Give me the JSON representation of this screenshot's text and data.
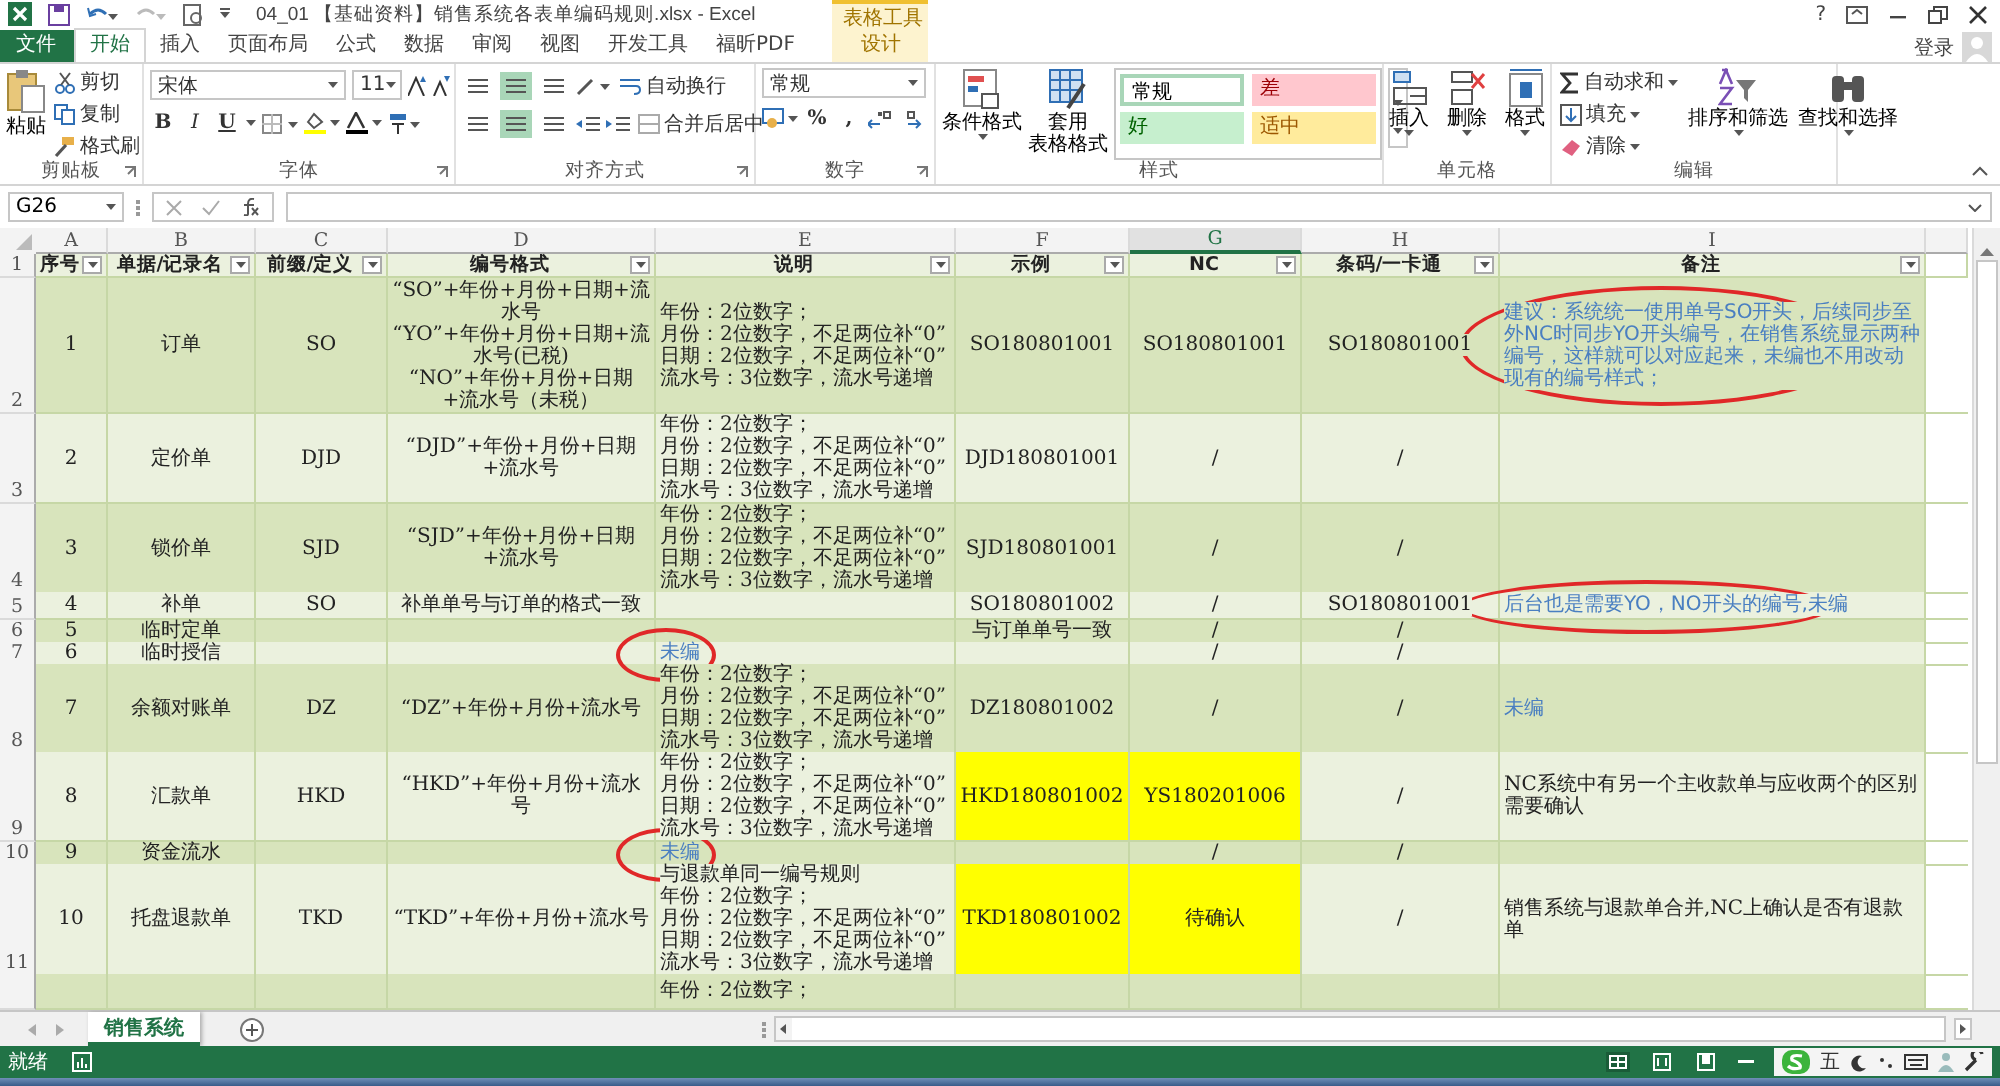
{
  "title_bar": {
    "title": "04_01  【基础资料】销售系统各表单编码规则.xlsx - Excel",
    "context_label": "表格工具",
    "help": "?",
    "login": "登录"
  },
  "ribbon_tabs": [
    {
      "label": "文件",
      "kind": "file",
      "selected": false
    },
    {
      "label": "开始",
      "kind": "normal",
      "selected": true
    },
    {
      "label": "插入",
      "kind": "normal",
      "selected": false
    },
    {
      "label": "页面布局",
      "kind": "normal",
      "selected": false
    },
    {
      "label": "公式",
      "kind": "normal",
      "selected": false
    },
    {
      "label": "数据",
      "kind": "normal",
      "selected": false
    },
    {
      "label": "审阅",
      "kind": "normal",
      "selected": false
    },
    {
      "label": "视图",
      "kind": "normal",
      "selected": false
    },
    {
      "label": "开发工具",
      "kind": "normal",
      "selected": false
    },
    {
      "label": "福昕PDF",
      "kind": "normal",
      "selected": false
    },
    {
      "label": "设计",
      "kind": "context",
      "selected": false
    }
  ],
  "ribbon": {
    "clipboard": {
      "paste": "粘贴",
      "cut": "剪切",
      "copy": "复制",
      "format_painter": "格式刷",
      "label": "剪贴板"
    },
    "font": {
      "name": "宋体",
      "size": "11",
      "styles": [
        "B",
        "I",
        "U"
      ],
      "label": "字体"
    },
    "alignment": {
      "wrap_text": "自动换行",
      "merge_center": "合并后居中",
      "label": "对齐方式"
    },
    "number": {
      "format": "常规",
      "symbols": [
        "%",
        ","
      ],
      "label": "数字"
    },
    "styles": {
      "conditional": "条件格式",
      "table_format": [
        "套用",
        "表格格式"
      ],
      "cell_styles": [
        {
          "label": "常规",
          "kind": "normal",
          "color": "#ffffff"
        },
        {
          "label": "差",
          "kind": "bad",
          "color": "#ffc7ce"
        },
        {
          "label": "好",
          "kind": "good",
          "color": "#c6efce"
        },
        {
          "label": "适中",
          "kind": "neutral",
          "color": "#ffeb9c"
        }
      ],
      "label": "样式"
    },
    "cells": {
      "insert": "插入",
      "delete": "删除",
      "format": "格式",
      "label": "单元格"
    },
    "editing": {
      "autosum": "自动求和",
      "fill": "填充",
      "clear": "清除",
      "sort_filter": "排序和筛选",
      "find_select": "查找和选择",
      "label": "编辑"
    }
  },
  "formula_bar": {
    "name_box": "G26"
  },
  "sheet": {
    "columns": [
      {
        "letter": "A",
        "selected": false
      },
      {
        "letter": "B",
        "selected": false
      },
      {
        "letter": "C",
        "selected": false
      },
      {
        "letter": "D",
        "selected": false
      },
      {
        "letter": "E",
        "selected": false
      },
      {
        "letter": "F",
        "selected": false
      },
      {
        "letter": "G",
        "selected": true
      },
      {
        "letter": "H",
        "selected": false
      },
      {
        "letter": "I",
        "selected": false
      }
    ],
    "header_row": "1",
    "headers": [
      "序号",
      "单据/记录名",
      "前缀/定义",
      "编号格式",
      "说明",
      "示例",
      "NC",
      "条码/一卡通",
      "备注"
    ],
    "rows": [
      {
        "number": "2",
        "cells": [
          {
            "text": "1",
            "kind": "plain",
            "circled": false
          },
          {
            "text": "订单",
            "kind": "plain",
            "circled": false
          },
          {
            "text": "SO",
            "kind": "plain",
            "circled": false
          },
          {
            "lines": [
              "“SO”+年份+月份+日期+流水号",
              "“YO”+年份+月份+日期+流水号(已税)",
              "“NO”+年份+月份+日期+流水号（未税）"
            ],
            "kind": "plain",
            "circled": false
          },
          {
            "lines": [
              "年份：2位数字；",
              "月份：2位数字，不足两位补“0”",
              "日期：2位数字，不足两位补“0”",
              "流水号：3位数字，流水号递增"
            ],
            "kind": "plain",
            "circled": false
          },
          {
            "text": "SO180801001",
            "kind": "plain",
            "circled": false
          },
          {
            "text": "SO180801001",
            "kind": "plain",
            "circled": false
          },
          {
            "text": "SO180801001",
            "kind": "plain",
            "circled": false
          },
          {
            "text": "建议：系统统一使用单号SO开头，后续同步至外NC时同步YO开头编号，在销售系统显示两种编号，这样就可以对应起来，未编也不用改动现有的编号样式；",
            "kind": "note",
            "circled": true
          }
        ]
      },
      {
        "number": "3",
        "cells": [
          {
            "text": "2",
            "kind": "plain",
            "circled": false
          },
          {
            "text": "定价单",
            "kind": "plain",
            "circled": false
          },
          {
            "text": "DJD",
            "kind": "plain",
            "circled": false
          },
          {
            "text": "“DJD”+年份+月份+日期+流水号",
            "kind": "plain",
            "circled": false
          },
          {
            "lines": [
              "年份：2位数字；",
              "月份：2位数字，不足两位补“0”",
              "日期：2位数字，不足两位补“0”",
              "流水号：3位数字，流水号递增"
            ],
            "kind": "plain",
            "circled": false
          },
          {
            "text": "DJD180801001",
            "kind": "plain",
            "circled": false
          },
          {
            "text": "/",
            "kind": "plain",
            "circled": false
          },
          {
            "text": "/",
            "kind": "plain",
            "circled": false
          },
          {
            "kind": "plain",
            "circled": false
          }
        ]
      },
      {
        "number": "4",
        "cells": [
          {
            "text": "3",
            "kind": "plain",
            "circled": false
          },
          {
            "text": "锁价单",
            "kind": "plain",
            "circled": false
          },
          {
            "text": "SJD",
            "kind": "plain",
            "circled": false
          },
          {
            "text": "“SJD”+年份+月份+日期+流水号",
            "kind": "plain",
            "circled": false
          },
          {
            "lines": [
              "年份：2位数字；",
              "月份：2位数字，不足两位补“0”",
              "日期：2位数字，不足两位补“0”",
              "流水号：3位数字，流水号递增"
            ],
            "kind": "plain",
            "circled": false
          },
          {
            "text": "SJD180801001",
            "kind": "plain",
            "circled": false
          },
          {
            "text": "/",
            "kind": "plain",
            "circled": false
          },
          {
            "text": "/",
            "kind": "plain",
            "circled": false
          },
          {
            "kind": "plain",
            "circled": false
          }
        ]
      },
      {
        "number": "5",
        "cells": [
          {
            "text": "4",
            "kind": "plain",
            "circled": false
          },
          {
            "text": "补单",
            "kind": "plain",
            "circled": false
          },
          {
            "text": "SO",
            "kind": "plain",
            "circled": false
          },
          {
            "text": "补单单号与订单的格式一致",
            "kind": "plain",
            "circled": false
          },
          {
            "kind": "plain",
            "circled": false
          },
          {
            "text": "SO180801002",
            "kind": "plain",
            "circled": false
          },
          {
            "text": "/",
            "kind": "plain",
            "circled": false
          },
          {
            "text": "SO180801001",
            "kind": "plain",
            "circled": false
          },
          {
            "text": "后台也是需要YO，NO开头的编号,未编",
            "kind": "note",
            "circled": true
          }
        ]
      },
      {
        "number": "6",
        "cells": [
          {
            "text": "5",
            "kind": "plain",
            "circled": false
          },
          {
            "text": "临时定单",
            "kind": "plain",
            "circled": false
          },
          {
            "kind": "plain",
            "circled": false
          },
          {
            "kind": "plain",
            "circled": false
          },
          {
            "kind": "plain",
            "circled": false
          },
          {
            "text": "与订单单号一致",
            "kind": "plain",
            "circled": false
          },
          {
            "text": "/",
            "kind": "plain",
            "circled": false
          },
          {
            "text": "/",
            "kind": "plain",
            "circled": false
          },
          {
            "kind": "plain",
            "circled": false
          }
        ]
      },
      {
        "number": "7",
        "cells": [
          {
            "text": "6",
            "kind": "plain",
            "circled": false
          },
          {
            "text": "临时授信",
            "kind": "plain",
            "circled": false
          },
          {
            "kind": "plain",
            "circled": false
          },
          {
            "kind": "plain",
            "circled": false
          },
          {
            "text": "未编",
            "kind": "note",
            "circled": true
          },
          {
            "kind": "plain",
            "circled": false
          },
          {
            "text": "/",
            "kind": "plain",
            "circled": false
          },
          {
            "text": "/",
            "kind": "plain",
            "circled": false
          },
          {
            "kind": "plain",
            "circled": false
          }
        ]
      },
      {
        "number": "8",
        "cells": [
          {
            "text": "7",
            "kind": "plain",
            "circled": false
          },
          {
            "text": "余额对账单",
            "kind": "plain",
            "circled": false
          },
          {
            "text": "DZ",
            "kind": "plain",
            "circled": false
          },
          {
            "text": "“DZ”+年份+月份+流水号",
            "kind": "plain",
            "circled": false
          },
          {
            "lines": [
              "年份：2位数字；",
              "月份：2位数字，不足两位补“0”",
              "日期：2位数字，不足两位补“0”",
              "流水号：3位数字，流水号递增"
            ],
            "kind": "plain",
            "circled": false
          },
          {
            "text": "DZ180801002",
            "kind": "plain",
            "circled": false
          },
          {
            "text": "/",
            "kind": "plain",
            "circled": false
          },
          {
            "text": "/",
            "kind": "plain",
            "circled": false
          },
          {
            "text": "未编",
            "kind": "note",
            "circled": false
          }
        ]
      },
      {
        "number": "9",
        "cells": [
          {
            "text": "8",
            "kind": "plain",
            "circled": false
          },
          {
            "text": "汇款单",
            "kind": "plain",
            "circled": false
          },
          {
            "text": "HKD",
            "kind": "plain",
            "circled": false
          },
          {
            "text": "“HKD”+年份+月份+流水号",
            "kind": "plain",
            "circled": false
          },
          {
            "lines": [
              "年份：2位数字；",
              "月份：2位数字，不足两位补“0”",
              "日期：2位数字，不足两位补“0”",
              "流水号：3位数字，流水号递增"
            ],
            "kind": "plain",
            "circled": false
          },
          {
            "text": "HKD180801002",
            "kind": "flag",
            "circled": false
          },
          {
            "text": "YS180201006",
            "kind": "flag",
            "circled": false
          },
          {
            "text": "/",
            "kind": "plain",
            "circled": false
          },
          {
            "text": "NC系统中有另一个主收款单与应收两个的区别需要确认",
            "kind": "plain",
            "circled": false
          }
        ]
      },
      {
        "number": "10",
        "cells": [
          {
            "text": "9",
            "kind": "plain",
            "circled": false
          },
          {
            "text": "资金流水",
            "kind": "plain",
            "circled": false
          },
          {
            "kind": "plain",
            "circled": false
          },
          {
            "kind": "plain",
            "circled": false
          },
          {
            "text": "未编",
            "kind": "note",
            "circled": true
          },
          {
            "kind": "plain",
            "circled": false
          },
          {
            "text": "/",
            "kind": "plain",
            "circled": false
          },
          {
            "text": "/",
            "kind": "plain",
            "circled": false
          },
          {
            "kind": "plain",
            "circled": false
          }
        ]
      },
      {
        "number": "11",
        "cells": [
          {
            "text": "10",
            "kind": "plain",
            "circled": false
          },
          {
            "text": "托盘退款单",
            "kind": "plain",
            "circled": false
          },
          {
            "text": "TKD",
            "kind": "plain",
            "circled": false
          },
          {
            "text": "“TKD”+年份+月份+流水号",
            "kind": "plain",
            "circled": false
          },
          {
            "lines": [
              "与退款单同一编号规则",
              "年份：2位数字；",
              "月份：2位数字，不足两位补“0”",
              "日期：2位数字，不足两位补“0”",
              "流水号：3位数字，流水号递增"
            ],
            "kind": "plain",
            "circled": false
          },
          {
            "text": "TKD180801002",
            "kind": "flag",
            "circled": false
          },
          {
            "text": "待确认",
            "kind": "flag",
            "circled": false
          },
          {
            "text": "/",
            "kind": "plain",
            "circled": false
          },
          {
            "text": "销售系统与退款单合并,NC上确认是否有退款单",
            "kind": "plain",
            "circled": false
          }
        ]
      },
      {
        "cells": [
          {
            "kind": "plain",
            "circled": false
          },
          {
            "kind": "plain",
            "circled": false
          },
          {
            "kind": "plain",
            "circled": false
          },
          {
            "kind": "plain",
            "circled": false
          },
          {
            "text": "年份：2位数字；",
            "kind": "plain",
            "circled": false
          },
          {
            "kind": "plain",
            "circled": false
          },
          {
            "kind": "plain",
            "circled": false
          },
          {
            "kind": "plain",
            "circled": false
          },
          {
            "kind": "plain",
            "circled": false
          }
        ]
      }
    ]
  },
  "sheet_tabs": [
    {
      "label": "销售系统",
      "selected": true
    }
  ],
  "status_bar": {
    "status": "就绪",
    "ime_mode": "五"
  }
}
